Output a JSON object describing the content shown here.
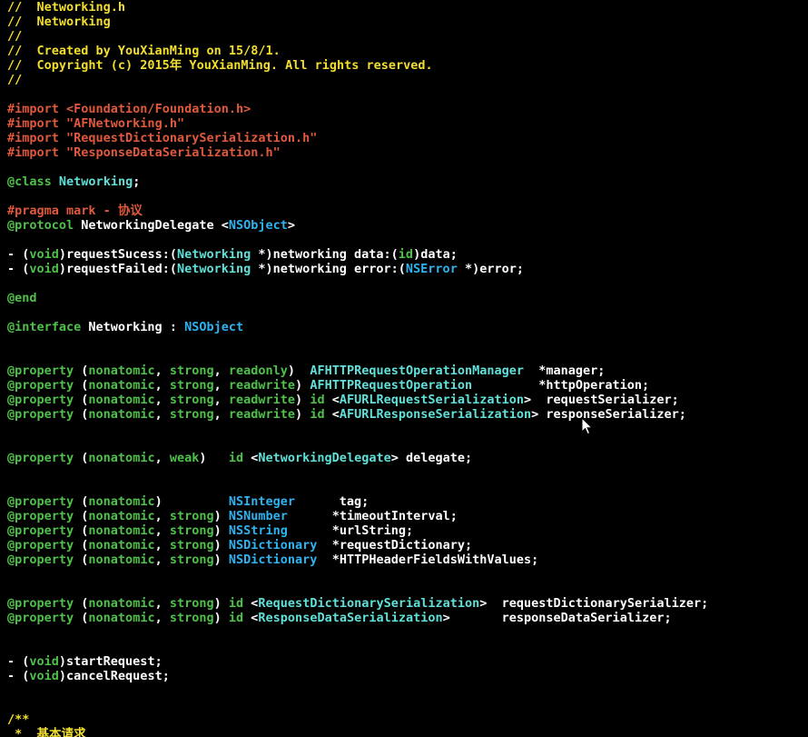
{
  "editor": {
    "theme": {
      "background": "#000000",
      "comment": "#f2de2f",
      "directive": "#e0593d",
      "string": "#e0593d",
      "keyword": "#4fc14a",
      "type": "#2fb3f0",
      "class": "#60e0d8",
      "plain": "#ffffff"
    },
    "lines": [
      [
        {
          "t": "comment",
          "v": "//  Networking.h"
        }
      ],
      [
        {
          "t": "comment",
          "v": "//  Networking"
        }
      ],
      [
        {
          "t": "comment",
          "v": "//"
        }
      ],
      [
        {
          "t": "comment",
          "v": "//  Created by YouXianMing on 15/8/1."
        }
      ],
      [
        {
          "t": "comment",
          "v": "//  Copyright (c) 2015年 YouXianMing. All rights reserved."
        }
      ],
      [
        {
          "t": "comment",
          "v": "//"
        }
      ],
      [],
      [
        {
          "t": "directive",
          "v": "#import "
        },
        {
          "t": "string",
          "v": "<Foundation/Foundation.h>"
        }
      ],
      [
        {
          "t": "directive",
          "v": "#import "
        },
        {
          "t": "string",
          "v": "\"AFNetworking.h\""
        }
      ],
      [
        {
          "t": "directive",
          "v": "#import "
        },
        {
          "t": "string",
          "v": "\"RequestDictionarySerialization.h\""
        }
      ],
      [
        {
          "t": "directive",
          "v": "#import "
        },
        {
          "t": "string",
          "v": "\"ResponseDataSerialization.h\""
        }
      ],
      [],
      [
        {
          "t": "keyword",
          "v": "@class"
        },
        {
          "t": "plain",
          "v": " "
        },
        {
          "t": "class",
          "v": "Networking"
        },
        {
          "t": "plain",
          "v": ";"
        }
      ],
      [],
      [
        {
          "t": "directive",
          "v": "#pragma mark - 协议"
        }
      ],
      [
        {
          "t": "keyword",
          "v": "@protocol"
        },
        {
          "t": "plain",
          "v": " NetworkingDelegate <"
        },
        {
          "t": "type",
          "v": "NSObject"
        },
        {
          "t": "plain",
          "v": ">"
        }
      ],
      [],
      [
        {
          "t": "plain",
          "v": "- ("
        },
        {
          "t": "keyword",
          "v": "void"
        },
        {
          "t": "plain",
          "v": ")requestSucess:("
        },
        {
          "t": "class",
          "v": "Networking"
        },
        {
          "t": "plain",
          "v": " *)networking data:("
        },
        {
          "t": "keyword",
          "v": "id"
        },
        {
          "t": "plain",
          "v": ")data;"
        }
      ],
      [
        {
          "t": "plain",
          "v": "- ("
        },
        {
          "t": "keyword",
          "v": "void"
        },
        {
          "t": "plain",
          "v": ")requestFailed:("
        },
        {
          "t": "class",
          "v": "Networking"
        },
        {
          "t": "plain",
          "v": " *)networking error:("
        },
        {
          "t": "type",
          "v": "NSError"
        },
        {
          "t": "plain",
          "v": " *)error;"
        }
      ],
      [],
      [
        {
          "t": "keyword",
          "v": "@end"
        }
      ],
      [],
      [
        {
          "t": "keyword",
          "v": "@interface"
        },
        {
          "t": "plain",
          "v": " Networking : "
        },
        {
          "t": "type",
          "v": "NSObject"
        }
      ],
      [],
      [],
      [
        {
          "t": "keyword",
          "v": "@property"
        },
        {
          "t": "plain",
          "v": " ("
        },
        {
          "t": "keyword",
          "v": "nonatomic"
        },
        {
          "t": "plain",
          "v": ", "
        },
        {
          "t": "keyword",
          "v": "strong"
        },
        {
          "t": "plain",
          "v": ", "
        },
        {
          "t": "keyword",
          "v": "readonly"
        },
        {
          "t": "plain",
          "v": ")  "
        },
        {
          "t": "class",
          "v": "AFHTTPRequestOperationManager"
        },
        {
          "t": "plain",
          "v": "  *manager;"
        }
      ],
      [
        {
          "t": "keyword",
          "v": "@property"
        },
        {
          "t": "plain",
          "v": " ("
        },
        {
          "t": "keyword",
          "v": "nonatomic"
        },
        {
          "t": "plain",
          "v": ", "
        },
        {
          "t": "keyword",
          "v": "strong"
        },
        {
          "t": "plain",
          "v": ", "
        },
        {
          "t": "keyword",
          "v": "readwrite"
        },
        {
          "t": "plain",
          "v": ") "
        },
        {
          "t": "class",
          "v": "AFHTTPRequestOperation"
        },
        {
          "t": "plain",
          "v": "         *httpOperation;"
        }
      ],
      [
        {
          "t": "keyword",
          "v": "@property"
        },
        {
          "t": "plain",
          "v": " ("
        },
        {
          "t": "keyword",
          "v": "nonatomic"
        },
        {
          "t": "plain",
          "v": ", "
        },
        {
          "t": "keyword",
          "v": "strong"
        },
        {
          "t": "plain",
          "v": ", "
        },
        {
          "t": "keyword",
          "v": "readwrite"
        },
        {
          "t": "plain",
          "v": ") "
        },
        {
          "t": "keyword",
          "v": "id"
        },
        {
          "t": "plain",
          "v": " <"
        },
        {
          "t": "class",
          "v": "AFURLRequestSerialization"
        },
        {
          "t": "plain",
          "v": ">  requestSerializer;"
        }
      ],
      [
        {
          "t": "keyword",
          "v": "@property"
        },
        {
          "t": "plain",
          "v": " ("
        },
        {
          "t": "keyword",
          "v": "nonatomic"
        },
        {
          "t": "plain",
          "v": ", "
        },
        {
          "t": "keyword",
          "v": "strong"
        },
        {
          "t": "plain",
          "v": ", "
        },
        {
          "t": "keyword",
          "v": "readwrite"
        },
        {
          "t": "plain",
          "v": ") "
        },
        {
          "t": "keyword",
          "v": "id"
        },
        {
          "t": "plain",
          "v": " <"
        },
        {
          "t": "class",
          "v": "AFURLResponseSerialization"
        },
        {
          "t": "plain",
          "v": "> responseSerializer;"
        }
      ],
      [],
      [],
      [
        {
          "t": "keyword",
          "v": "@property"
        },
        {
          "t": "plain",
          "v": " ("
        },
        {
          "t": "keyword",
          "v": "nonatomic"
        },
        {
          "t": "plain",
          "v": ", "
        },
        {
          "t": "keyword",
          "v": "weak"
        },
        {
          "t": "plain",
          "v": ")   "
        },
        {
          "t": "keyword",
          "v": "id"
        },
        {
          "t": "plain",
          "v": " <"
        },
        {
          "t": "class",
          "v": "NetworkingDelegate"
        },
        {
          "t": "plain",
          "v": "> delegate;"
        }
      ],
      [],
      [],
      [
        {
          "t": "keyword",
          "v": "@property"
        },
        {
          "t": "plain",
          "v": " ("
        },
        {
          "t": "keyword",
          "v": "nonatomic"
        },
        {
          "t": "plain",
          "v": ")         "
        },
        {
          "t": "type",
          "v": "NSInteger"
        },
        {
          "t": "plain",
          "v": "      tag;"
        }
      ],
      [
        {
          "t": "keyword",
          "v": "@property"
        },
        {
          "t": "plain",
          "v": " ("
        },
        {
          "t": "keyword",
          "v": "nonatomic"
        },
        {
          "t": "plain",
          "v": ", "
        },
        {
          "t": "keyword",
          "v": "strong"
        },
        {
          "t": "plain",
          "v": ") "
        },
        {
          "t": "type",
          "v": "NSNumber"
        },
        {
          "t": "plain",
          "v": "      *timeoutInterval;"
        }
      ],
      [
        {
          "t": "keyword",
          "v": "@property"
        },
        {
          "t": "plain",
          "v": " ("
        },
        {
          "t": "keyword",
          "v": "nonatomic"
        },
        {
          "t": "plain",
          "v": ", "
        },
        {
          "t": "keyword",
          "v": "strong"
        },
        {
          "t": "plain",
          "v": ") "
        },
        {
          "t": "type",
          "v": "NSString"
        },
        {
          "t": "plain",
          "v": "      *urlString;"
        }
      ],
      [
        {
          "t": "keyword",
          "v": "@property"
        },
        {
          "t": "plain",
          "v": " ("
        },
        {
          "t": "keyword",
          "v": "nonatomic"
        },
        {
          "t": "plain",
          "v": ", "
        },
        {
          "t": "keyword",
          "v": "strong"
        },
        {
          "t": "plain",
          "v": ") "
        },
        {
          "t": "type",
          "v": "NSDictionary"
        },
        {
          "t": "plain",
          "v": "  *requestDictionary;"
        }
      ],
      [
        {
          "t": "keyword",
          "v": "@property"
        },
        {
          "t": "plain",
          "v": " ("
        },
        {
          "t": "keyword",
          "v": "nonatomic"
        },
        {
          "t": "plain",
          "v": ", "
        },
        {
          "t": "keyword",
          "v": "strong"
        },
        {
          "t": "plain",
          "v": ") "
        },
        {
          "t": "type",
          "v": "NSDictionary"
        },
        {
          "t": "plain",
          "v": "  *HTTPHeaderFieldsWithValues;"
        }
      ],
      [],
      [],
      [
        {
          "t": "keyword",
          "v": "@property"
        },
        {
          "t": "plain",
          "v": " ("
        },
        {
          "t": "keyword",
          "v": "nonatomic"
        },
        {
          "t": "plain",
          "v": ", "
        },
        {
          "t": "keyword",
          "v": "strong"
        },
        {
          "t": "plain",
          "v": ") "
        },
        {
          "t": "keyword",
          "v": "id"
        },
        {
          "t": "plain",
          "v": " <"
        },
        {
          "t": "class",
          "v": "RequestDictionarySerialization"
        },
        {
          "t": "plain",
          "v": ">  requestDictionarySerializer;"
        }
      ],
      [
        {
          "t": "keyword",
          "v": "@property"
        },
        {
          "t": "plain",
          "v": " ("
        },
        {
          "t": "keyword",
          "v": "nonatomic"
        },
        {
          "t": "plain",
          "v": ", "
        },
        {
          "t": "keyword",
          "v": "strong"
        },
        {
          "t": "plain",
          "v": ") "
        },
        {
          "t": "keyword",
          "v": "id"
        },
        {
          "t": "plain",
          "v": " <"
        },
        {
          "t": "class",
          "v": "ResponseDataSerialization"
        },
        {
          "t": "plain",
          "v": ">       responseDataSerializer;"
        }
      ],
      [],
      [],
      [
        {
          "t": "plain",
          "v": "- ("
        },
        {
          "t": "keyword",
          "v": "void"
        },
        {
          "t": "plain",
          "v": ")startRequest;"
        }
      ],
      [
        {
          "t": "plain",
          "v": "- ("
        },
        {
          "t": "keyword",
          "v": "void"
        },
        {
          "t": "plain",
          "v": ")cancelRequest;"
        }
      ],
      [],
      [],
      [
        {
          "t": "comment",
          "v": "/**"
        }
      ],
      [
        {
          "t": "comment",
          "v": " *  基本请求"
        }
      ]
    ]
  }
}
